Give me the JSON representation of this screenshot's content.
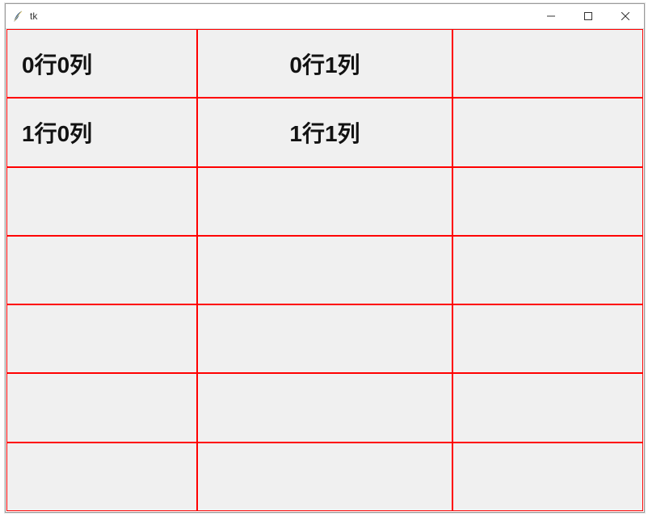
{
  "window": {
    "title": "tk"
  },
  "grid": {
    "rows": 7,
    "cols": 3,
    "cells": [
      [
        "0行0列",
        "0行1列",
        ""
      ],
      [
        "1行0列",
        "1行1列",
        ""
      ],
      [
        "",
        "",
        ""
      ],
      [
        "",
        "",
        ""
      ],
      [
        "",
        "",
        ""
      ],
      [
        "",
        "",
        ""
      ],
      [
        "",
        "",
        ""
      ]
    ]
  }
}
